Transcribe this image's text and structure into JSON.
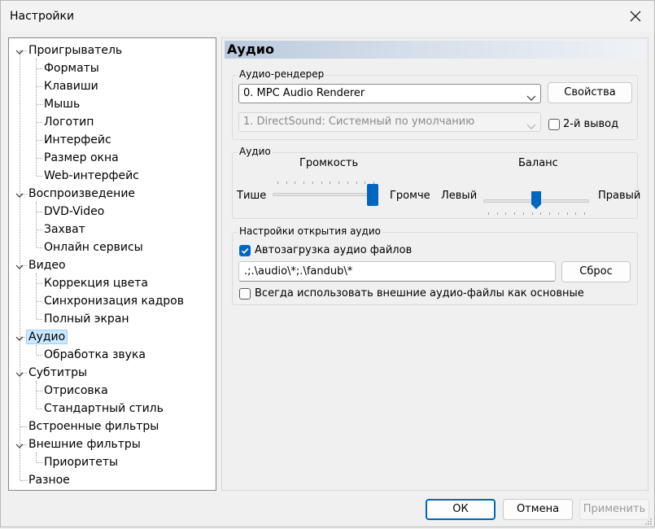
{
  "window": {
    "title": "Настройки"
  },
  "tree": {
    "items": [
      {
        "label": "Проигрыватель",
        "level": 0,
        "expanded": true
      },
      {
        "label": "Форматы",
        "level": 1
      },
      {
        "label": "Клавиши",
        "level": 1
      },
      {
        "label": "Мышь",
        "level": 1
      },
      {
        "label": "Логотип",
        "level": 1
      },
      {
        "label": "Интерфейс",
        "level": 1
      },
      {
        "label": "Размер окна",
        "level": 1
      },
      {
        "label": "Web-интерфейс",
        "level": 1
      },
      {
        "label": "Воспроизведение",
        "level": 0,
        "expanded": true
      },
      {
        "label": "DVD-Video",
        "level": 1
      },
      {
        "label": "Захват",
        "level": 1
      },
      {
        "label": "Онлайн сервисы",
        "level": 1
      },
      {
        "label": "Видео",
        "level": 0,
        "expanded": true
      },
      {
        "label": "Коррекция цвета",
        "level": 1
      },
      {
        "label": "Синхронизация кадров",
        "level": 1
      },
      {
        "label": "Полный экран",
        "level": 1
      },
      {
        "label": "Аудио",
        "level": 0,
        "expanded": true,
        "selected": true
      },
      {
        "label": "Обработка звука",
        "level": 1
      },
      {
        "label": "Субтитры",
        "level": 0,
        "expanded": true
      },
      {
        "label": "Отрисовка",
        "level": 1
      },
      {
        "label": "Стандартный стиль",
        "level": 1
      },
      {
        "label": "Встроенные фильтры",
        "level": 0,
        "expanded": false
      },
      {
        "label": "Внешние фильтры",
        "level": 0,
        "expanded": true
      },
      {
        "label": "Приоритеты",
        "level": 1
      },
      {
        "label": "Разное",
        "level": 0,
        "expanded": false
      }
    ]
  },
  "panel": {
    "header": "Аудио",
    "renderer_group": {
      "label": "Аудио-рендерер",
      "renderer_value": "0. MPC Audio Renderer",
      "properties_button": "Свойства",
      "secondary_value": "1. DirectSound: Системный по умолчанию",
      "second_output_label": "2-й вывод",
      "second_output_checked": false
    },
    "audio_group": {
      "label": "Аудио",
      "volume_label": "Громкость",
      "volume_min_label": "Тише",
      "volume_max_label": "Громче",
      "volume_fraction": 1.0,
      "balance_label": "Баланс",
      "balance_left_label": "Левый",
      "balance_right_label": "Правый",
      "balance_fraction": 0.5
    },
    "open_group": {
      "label": "Настройки открытия аудио",
      "autoload_label": "Автозагрузка аудио файлов",
      "autoload_checked": true,
      "autoload_paths": ".;.\\audio\\*;.\\fandub\\*",
      "reset_button": "Сброс",
      "external_label": "Всегда использовать внешние аудио-файлы как основные",
      "external_checked": false
    }
  },
  "footer": {
    "ok": "ОК",
    "cancel": "Отмена",
    "apply": "Применить"
  }
}
